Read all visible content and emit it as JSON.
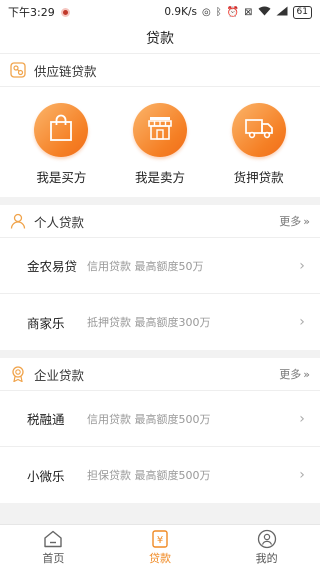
{
  "status_bar": {
    "time": "下午3:29",
    "speed": "0.9K/s",
    "battery": "61"
  },
  "header": {
    "title": "贷款"
  },
  "supply_chain": {
    "title": "供应链贷款",
    "items": [
      {
        "label": "我是买方",
        "icon": "shopping-bag-icon"
      },
      {
        "label": "我是卖方",
        "icon": "storefront-icon"
      },
      {
        "label": "货押贷款",
        "icon": "truck-icon"
      }
    ]
  },
  "personal": {
    "title": "个人贷款",
    "more": "更多",
    "items": [
      {
        "name": "金农易贷",
        "desc": "信用贷款 最高额度50万"
      },
      {
        "name": "商家乐",
        "desc": "抵押贷款 最高额度300万"
      }
    ]
  },
  "enterprise": {
    "title": "企业贷款",
    "more": "更多",
    "items": [
      {
        "name": "税融通",
        "desc": "信用贷款 最高额度500万"
      },
      {
        "name": "小微乐",
        "desc": "担保贷款 最高额度500万"
      }
    ]
  },
  "tabbar": {
    "tabs": [
      {
        "label": "首页",
        "icon": "home-icon"
      },
      {
        "label": "贷款",
        "icon": "yuan-icon",
        "active": true
      },
      {
        "label": "我的",
        "icon": "user-icon"
      }
    ]
  },
  "colors": {
    "accent": "#f57f24",
    "tab_active": "#f08a24"
  }
}
